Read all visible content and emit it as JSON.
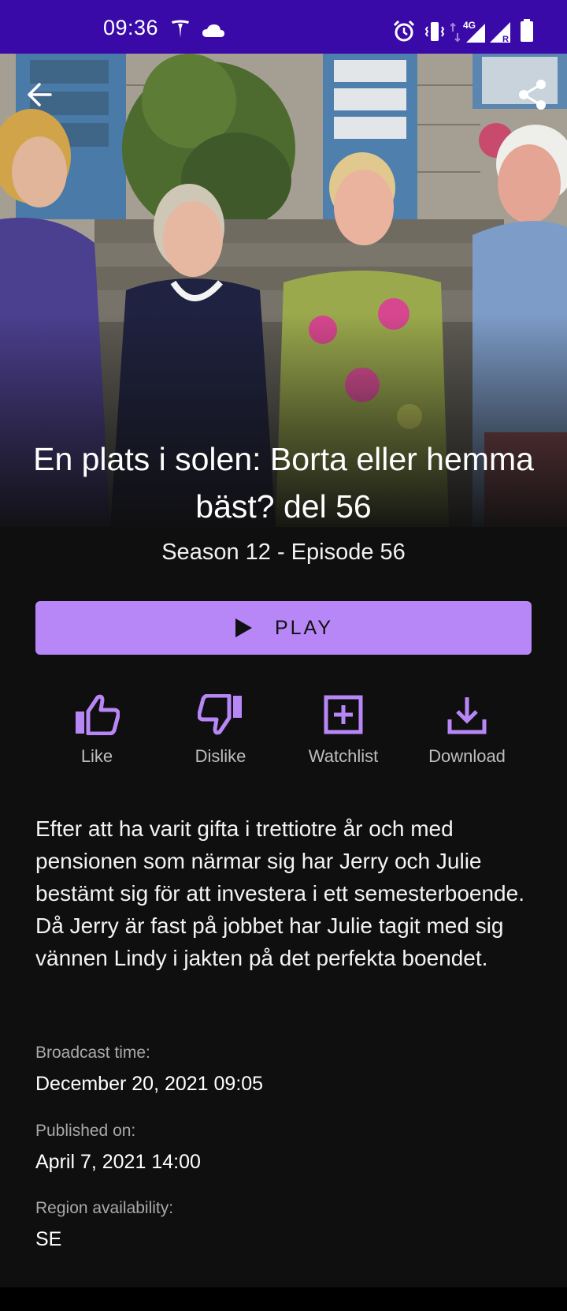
{
  "status_bar": {
    "time": "09:36",
    "icons": [
      "tesla-icon",
      "cloud-icon",
      "alarm-icon",
      "vibrate-icon",
      "data-arrows-icon",
      "signal-4g-icon",
      "signal-r-icon",
      "battery-icon"
    ],
    "network": "4G",
    "roaming": "R",
    "background": "#3a0aa8"
  },
  "header": {
    "back_icon": "arrow-left-icon",
    "share_icon": "share-icon"
  },
  "program": {
    "title": "En plats i solen: Borta eller hemma bäst? del 56",
    "episode_line": "Season 12 - Episode 56"
  },
  "play": {
    "label": "PLAY",
    "icon": "play-icon",
    "color": "#b887f7"
  },
  "actions": [
    {
      "label": "Like",
      "icon": "thumbs-up-icon"
    },
    {
      "label": "Dislike",
      "icon": "thumbs-down-icon"
    },
    {
      "label": "Watchlist",
      "icon": "add-square-icon"
    },
    {
      "label": "Download",
      "icon": "download-icon"
    }
  ],
  "accent_color": "#b887f7",
  "description": "Efter att ha varit gifta i trettiotre år och med pensionen som närmar sig har Jerry och Julie bestämt sig för att investera i ett semesterboende. Då Jerry är fast på jobbet har Julie tagit med sig vännen Lindy i jakten på det perfekta boendet.",
  "details": {
    "broadcast_label": "Broadcast time:",
    "broadcast_value": "December 20, 2021 09:05",
    "published_label": "Published on:",
    "published_value": "April 7, 2021 14:00",
    "region_label": "Region availability:",
    "region_value": "SE"
  }
}
